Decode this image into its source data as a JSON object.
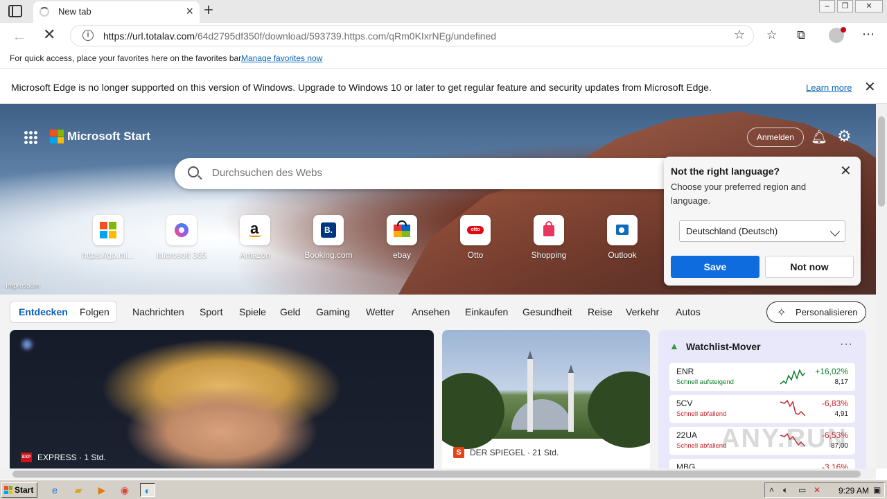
{
  "tab": {
    "title": "New tab"
  },
  "address": {
    "url_host": "https://url.totalav.com",
    "url_path": "/64d2795df350f/download/593739.https.com/qRm0KIxrNEg/undefined"
  },
  "favorites_bar": {
    "text": "For quick access, place your favorites here on the favorites bar.",
    "link": "Manage favorites now"
  },
  "infobar": {
    "text": "Microsoft Edge is no longer supported on this version of Windows. Upgrade to Windows 10 or later to get regular feature and security updates from Microsoft Edge.",
    "link": "Learn more"
  },
  "header": {
    "brand": "Microsoft Start",
    "signin": "Anmelden"
  },
  "search": {
    "placeholder": "Durchsuchen des Webs"
  },
  "tiles": [
    {
      "label": "https://go.mi..."
    },
    {
      "label": "Microsoft 365"
    },
    {
      "label": "Amazon"
    },
    {
      "label": "Booking.com"
    },
    {
      "label": "ebay"
    },
    {
      "label": "Otto"
    },
    {
      "label": "Shopping"
    },
    {
      "label": "Outlook"
    }
  ],
  "impressum": "Impressum",
  "language_popup": {
    "title": "Not the right language?",
    "description": "Choose your preferred region and language.",
    "selected": "Deutschland (Deutsch)",
    "save": "Save",
    "not_now": "Not now"
  },
  "feed": {
    "toggle_active": "Entdecken",
    "toggle_inactive": "Folgen",
    "categories": [
      "Nachrichten",
      "Sport",
      "Spiele",
      "Geld",
      "Gaming",
      "Wetter",
      "Ansehen",
      "Einkaufen",
      "Gesundheit",
      "Reise",
      "Verkehr",
      "Autos"
    ],
    "personalize": "Personalisieren"
  },
  "cards": {
    "main_source": "EXPRESS · 1 Std.",
    "mid_source": "DER SPIEGEL · 21 Std."
  },
  "watchlist": {
    "title": "Watchlist-Mover",
    "rows": [
      {
        "symbol": "ENR",
        "trend": "Schnell aufsteigend",
        "change": "+16,02%",
        "price": "8,17",
        "direction": "up"
      },
      {
        "symbol": "5CV",
        "trend": "Schnell abfallend",
        "change": "-6,83%",
        "price": "4,91",
        "direction": "down"
      },
      {
        "symbol": "22UA",
        "trend": "Schnell abfallend",
        "change": "-6,53%",
        "price": "87,00",
        "direction": "down"
      },
      {
        "symbol": "MBG",
        "trend": "",
        "change": "-3,16%",
        "price": "",
        "direction": "down"
      }
    ]
  },
  "watermark": "ANY.RUN",
  "taskbar": {
    "start": "Start",
    "clock": "9:29 AM"
  },
  "colors": {
    "accent": "#0f6cde",
    "up": "#0a7b2a",
    "down": "#c4262e"
  }
}
